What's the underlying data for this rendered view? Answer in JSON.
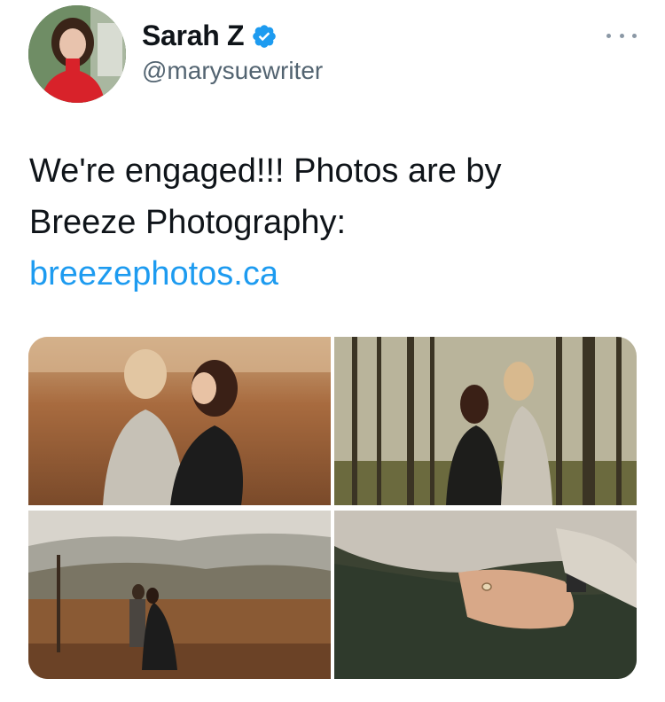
{
  "tweet": {
    "author": {
      "display_name": "Sarah Z",
      "handle": "@marysuewriter",
      "verified": true,
      "avatar_icon": "profile-avatar"
    },
    "more_icon": "more-dots-icon",
    "text_lines": [
      "We're engaged!!! Photos are by",
      "Breeze Photography:"
    ],
    "link_text": "breezephotos.ca",
    "media": [
      {
        "description_icon": "photo-couple-field"
      },
      {
        "description_icon": "photo-couple-forest"
      },
      {
        "description_icon": "photo-couple-mountains"
      },
      {
        "description_icon": "photo-hands-ring"
      }
    ]
  },
  "colors": {
    "text": "#0f1419",
    "secondary": "#536471",
    "link": "#1d9bf0",
    "verified": "#1d9bf0"
  }
}
